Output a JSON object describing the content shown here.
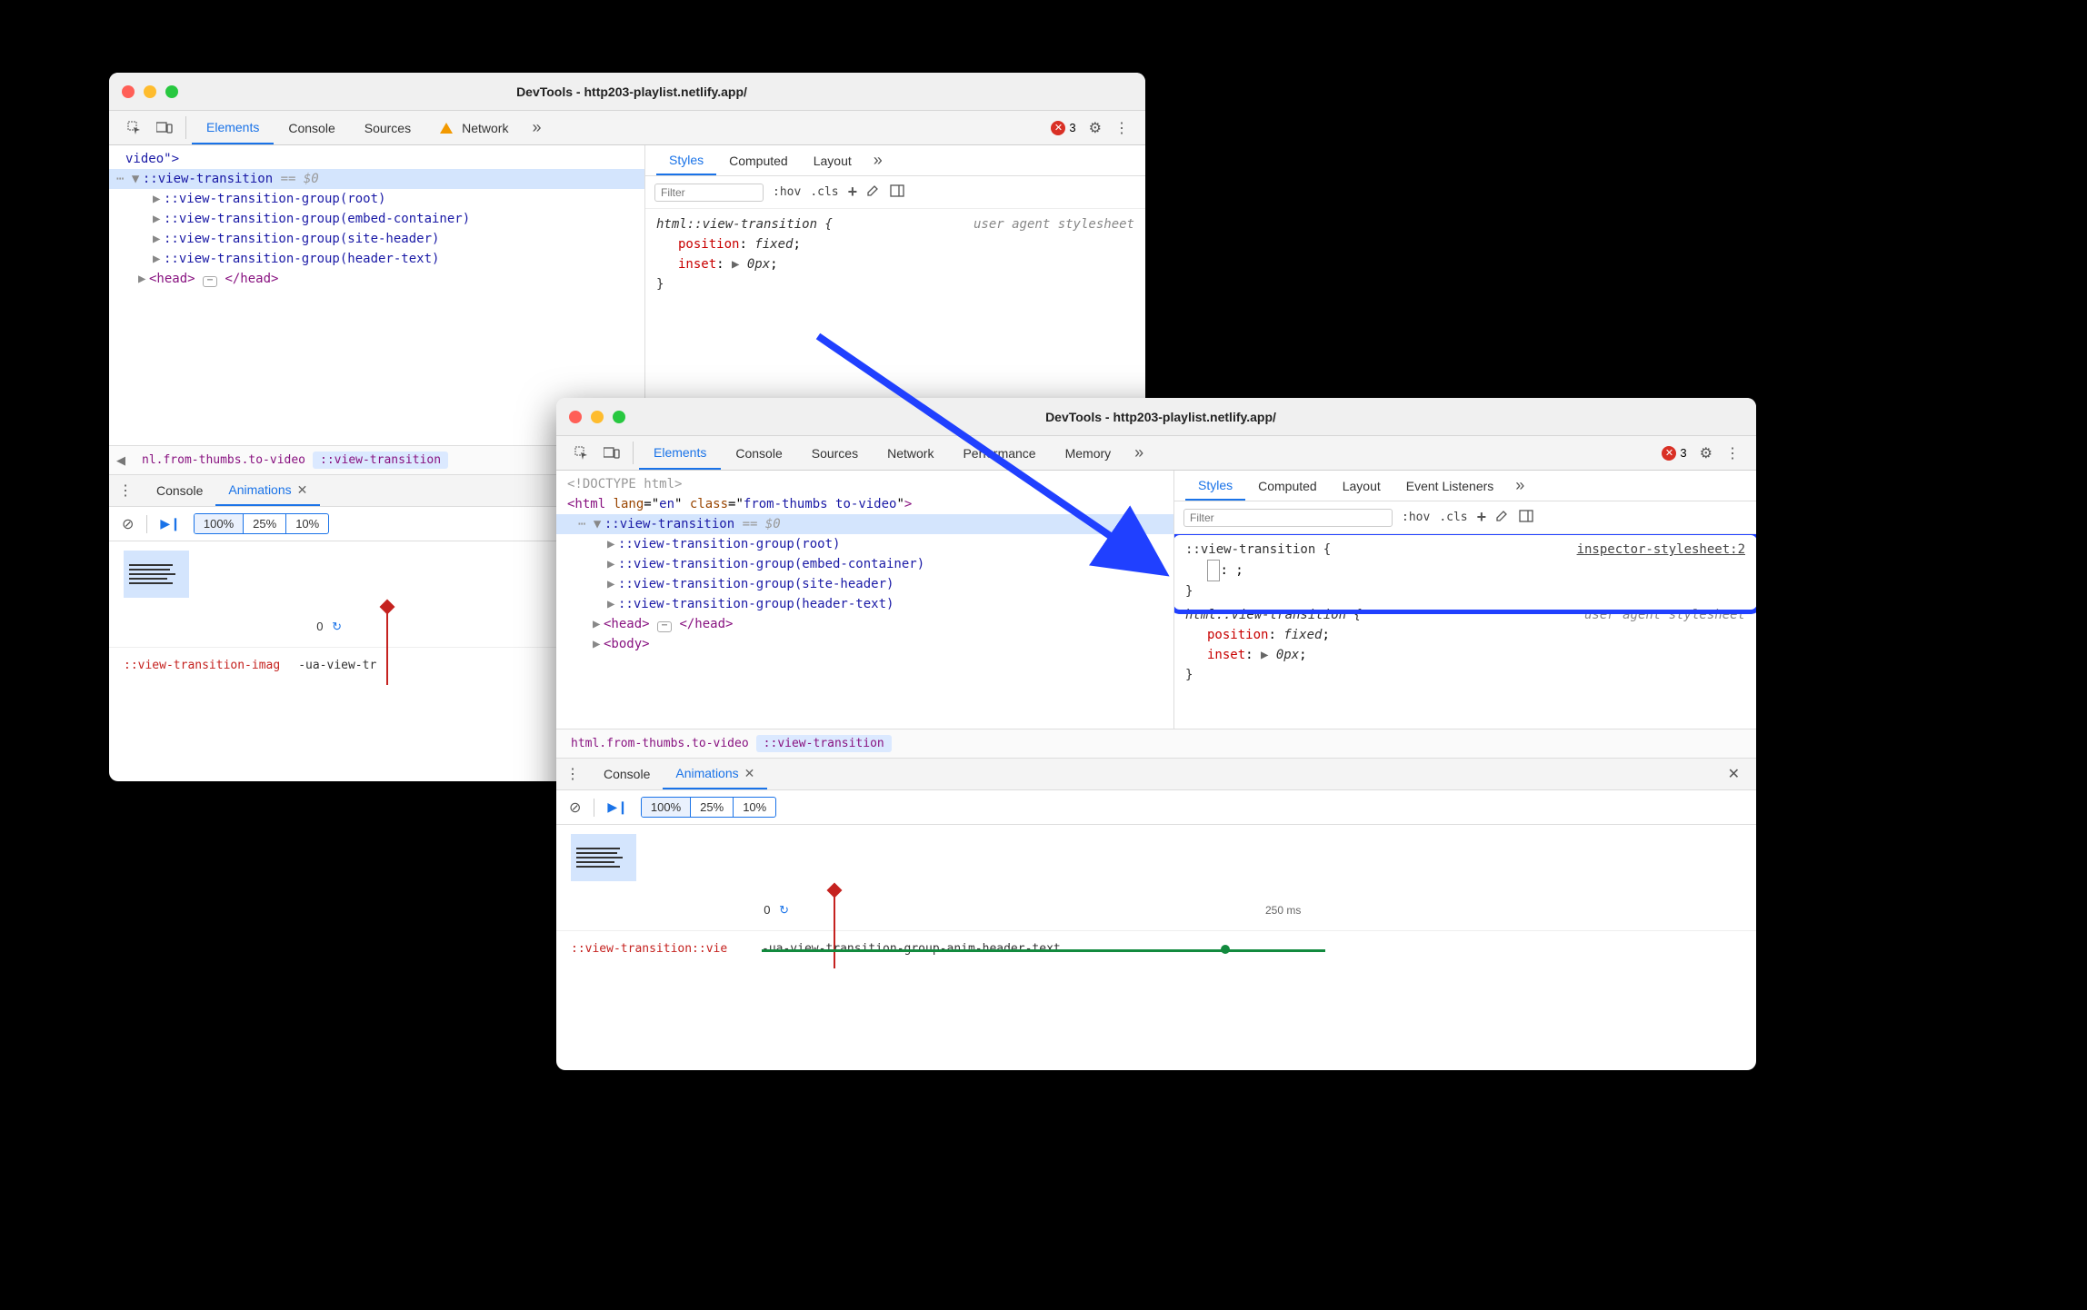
{
  "window_small": {
    "title": "DevTools - http203-playlist.netlify.app/",
    "main_tabs": [
      "Elements",
      "Console",
      "Sources",
      "Network"
    ],
    "main_tabs_active": 0,
    "network_has_warning": true,
    "error_count": "3",
    "dom": {
      "line0": "video\">",
      "sel_node": "::view-transition",
      "sel_eq": " == $0",
      "groups": [
        "::view-transition-group(root)",
        "::view-transition-group(embed-container)",
        "::view-transition-group(site-header)",
        "::view-transition-group(header-text)"
      ],
      "head_open": "<head>",
      "head_close": "</head>"
    },
    "breadcrumbs": [
      "nl.from-thumbs.to-video",
      "::view-transition"
    ],
    "styles_tabs": [
      "Styles",
      "Computed",
      "Layout"
    ],
    "styles_toolbar": {
      "filter_placeholder": "Filter",
      "hov": ":hov",
      "cls": ".cls"
    },
    "rule": {
      "selector": "html::view-transition {",
      "source": "user agent stylesheet",
      "props": [
        {
          "name": "position",
          "value": "fixed"
        },
        {
          "name": "inset",
          "value": "0px",
          "expandable": true
        }
      ],
      "close": "}"
    },
    "drawer_tabs": [
      "Console",
      "Animations"
    ],
    "drawer_active": 1,
    "speeds": [
      "100%",
      "25%",
      "10%"
    ],
    "speed_active": 0,
    "timeline_zero": "0",
    "track_selector": "::view-transition-imag",
    "track_anim": "-ua-view-tr"
  },
  "window_large": {
    "title": "DevTools - http203-playlist.netlify.app/",
    "main_tabs": [
      "Elements",
      "Console",
      "Sources",
      "Network",
      "Performance",
      "Memory"
    ],
    "main_tabs_active": 0,
    "error_count": "3",
    "dom": {
      "doctype": "<!DOCTYPE html>",
      "html_open": "<html lang=\"en\" class=\"from-thumbs to-video\">",
      "sel_node": "::view-transition",
      "sel_eq": " == $0",
      "groups": [
        "::view-transition-group(root)",
        "::view-transition-group(embed-container)",
        "::view-transition-group(site-header)",
        "::view-transition-group(header-text)"
      ],
      "head_open": "<head>",
      "head_close": "</head>",
      "body_open": "<body>"
    },
    "breadcrumbs": [
      "html.from-thumbs.to-video",
      "::view-transition"
    ],
    "styles_tabs": [
      "Styles",
      "Computed",
      "Layout",
      "Event Listeners"
    ],
    "styles_toolbar": {
      "filter_placeholder": "Filter",
      "hov": ":hov",
      "cls": ".cls"
    },
    "new_rule": {
      "selector": "::view-transition {",
      "source": "inspector-stylesheet:2",
      "editing_placeholder": ": ;",
      "close": "}"
    },
    "ua_rule": {
      "selector": "html::view-transition {",
      "source": "user agent stylesheet",
      "props": [
        {
          "name": "position",
          "value": "fixed"
        },
        {
          "name": "inset",
          "value": "0px",
          "expandable": true
        }
      ],
      "close": "}"
    },
    "drawer_tabs": [
      "Console",
      "Animations"
    ],
    "drawer_active": 1,
    "speeds": [
      "100%",
      "25%",
      "10%"
    ],
    "speed_active": 0,
    "timeline_zero": "0",
    "timeline_tick": "250 ms",
    "track_selector": "::view-transition::vie",
    "track_anim": "-ua-view-transition-group-anim-header-text"
  },
  "arrow": {
    "note": "blue arrow from small-window styles to large-window new rule"
  }
}
